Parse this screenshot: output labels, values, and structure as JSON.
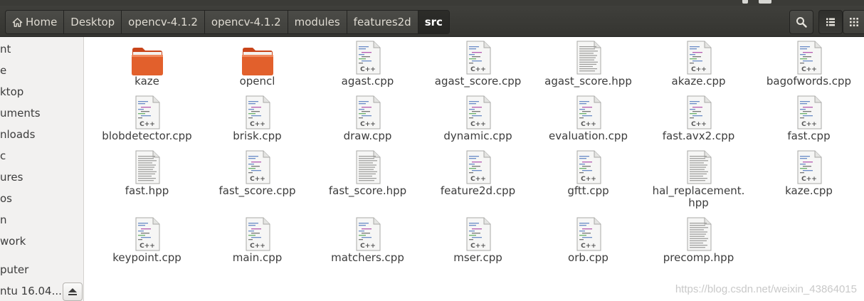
{
  "colors": {
    "toolbar": "#3b3b37",
    "folder": "#e2602c",
    "sidebar": "#f2f1f0",
    "text": "#3c3c3c"
  },
  "breadcrumb": [
    {
      "label": "Home",
      "icon": "home-icon"
    },
    {
      "label": "Desktop"
    },
    {
      "label": "opencv-4.1.2"
    },
    {
      "label": "opencv-4.1.2"
    },
    {
      "label": "modules"
    },
    {
      "label": "features2d"
    },
    {
      "label": "src",
      "active": true
    }
  ],
  "toolbar_buttons": [
    {
      "icon": "search-icon"
    },
    {
      "icon": "list-view-icon"
    },
    {
      "icon": "grid-view-icon"
    }
  ],
  "sidebar": {
    "items": [
      "nt",
      "e",
      "ktop",
      "uments",
      "nloads",
      "c",
      "ures",
      "os",
      "n",
      "work",
      "puter",
      "ntu 16.04...."
    ],
    "eject_icon": "eject-icon"
  },
  "files": [
    {
      "name": "kaze",
      "type": "folder"
    },
    {
      "name": "opencl",
      "type": "folder"
    },
    {
      "name": "agast.cpp",
      "type": "cpp"
    },
    {
      "name": "agast_score.cpp",
      "type": "cpp"
    },
    {
      "name": "agast_score.hpp",
      "type": "hpp"
    },
    {
      "name": "akaze.cpp",
      "type": "cpp"
    },
    {
      "name": "bagofwords.cpp",
      "type": "cpp"
    },
    {
      "name": "blobdetector.cpp",
      "type": "cpp"
    },
    {
      "name": "brisk.cpp",
      "type": "cpp"
    },
    {
      "name": "draw.cpp",
      "type": "cpp"
    },
    {
      "name": "dynamic.cpp",
      "type": "cpp"
    },
    {
      "name": "evaluation.cpp",
      "type": "cpp"
    },
    {
      "name": "fast.avx2.cpp",
      "type": "cpp"
    },
    {
      "name": "fast.cpp",
      "type": "cpp"
    },
    {
      "name": "fast.hpp",
      "type": "hpp"
    },
    {
      "name": "fast_score.cpp",
      "type": "cpp"
    },
    {
      "name": "fast_score.hpp",
      "type": "hpp"
    },
    {
      "name": "feature2d.cpp",
      "type": "cpp"
    },
    {
      "name": "gftt.cpp",
      "type": "cpp"
    },
    {
      "name": "hal_replacement.\nhpp",
      "type": "hpp"
    },
    {
      "name": "kaze.cpp",
      "type": "cpp"
    },
    {
      "name": "keypoint.cpp",
      "type": "cpp"
    },
    {
      "name": "main.cpp",
      "type": "cpp"
    },
    {
      "name": "matchers.cpp",
      "type": "cpp"
    },
    {
      "name": "mser.cpp",
      "type": "cpp"
    },
    {
      "name": "orb.cpp",
      "type": "cpp"
    },
    {
      "name": "precomp.hpp",
      "type": "hpp"
    }
  ],
  "watermark": "https://blog.csdn.net/weixin_43864015"
}
